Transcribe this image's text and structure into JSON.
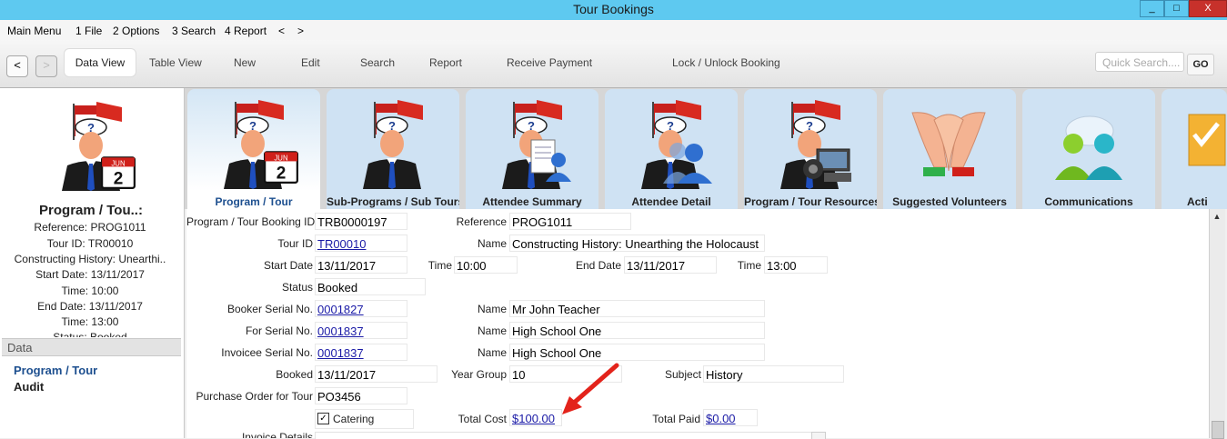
{
  "window": {
    "title": "Tour Bookings",
    "min": "_",
    "max": "□",
    "close": "X"
  },
  "menu": [
    "Main Menu",
    "1 File",
    "2 Options",
    "3 Search",
    "4 Report",
    "<",
    ">"
  ],
  "toolbar": {
    "back": "<",
    "forward": ">",
    "data_view": "Data View",
    "table_view": "Table View",
    "new": "New",
    "edit": "Edit",
    "search": "Search",
    "report": "Report",
    "receive_payment": "Receive Payment",
    "lock_unlock": "Lock / Unlock Booking",
    "quick_search_placeholder": "Quick Search....",
    "go": "GO"
  },
  "left": {
    "heading": "Program / Tou..:",
    "lines": [
      "Reference: PROG1011",
      "Tour ID: TR00010",
      "Constructing History: Unearthi..",
      "Start Date: 13/11/2017",
      "Time: 10:00",
      "End Date: 13/11/2017",
      "Time: 13:00",
      "Status: Booked"
    ],
    "section": "Data",
    "links": [
      "Program / Tour",
      "Audit"
    ],
    "calendar_month": "JUN",
    "calendar_day": "2"
  },
  "tabs": [
    {
      "label": "Program / Tour",
      "active": true
    },
    {
      "label": "Sub-Programs / Sub Tours",
      "active": false
    },
    {
      "label": "Attendee Summary",
      "active": false
    },
    {
      "label": "Attendee Detail",
      "active": false
    },
    {
      "label": "Program / Tour Resources",
      "active": false
    },
    {
      "label": "Suggested Volunteers",
      "active": false
    },
    {
      "label": "Communications",
      "active": false
    },
    {
      "label": "Acti",
      "active": false
    }
  ],
  "form": {
    "booking_id_label": "Program / Tour Booking ID",
    "booking_id": "TRB0000197",
    "reference_label": "Reference",
    "reference": "PROG1011",
    "tour_id_label": "Tour ID",
    "tour_id": "TR00010",
    "name_label": "Name",
    "tour_name": "Constructing History: Unearthing the Holocaust",
    "start_date_label": "Start Date",
    "start_date": "13/11/2017",
    "time_label": "Time",
    "start_time": "10:00",
    "end_date_label": "End Date",
    "end_date": "13/11/2017",
    "end_time": "13:00",
    "status_label": "Status",
    "status": "Booked",
    "booker_serial_label": "Booker Serial No.",
    "booker_serial": "0001827",
    "booker_name": "Mr John Teacher",
    "for_serial_label": "For Serial No.",
    "for_serial": "0001837",
    "for_name": "High School One",
    "invoicee_serial_label": "Invoicee Serial No.",
    "invoicee_serial": "0001837",
    "invoicee_name": "High School One",
    "booked_label": "Booked",
    "booked": "13/11/2017",
    "year_group_label": "Year Group",
    "year_group": "10",
    "subject_label": "Subject",
    "subject": "History",
    "po_label": "Purchase Order for Tour",
    "po": "PO3456",
    "catering_label": "Catering",
    "catering_checked": true,
    "total_cost_label": "Total Cost",
    "total_cost": "$100.00",
    "total_paid_label": "Total Paid",
    "total_paid": "$0.00",
    "invoice_details_label": "Invoice Details"
  },
  "colors": {
    "titlebar": "#5ec9f0",
    "close": "#c7312b",
    "link": "#1a1aa6",
    "arrow": "#e3231b",
    "tab": "#cfe2f3"
  }
}
